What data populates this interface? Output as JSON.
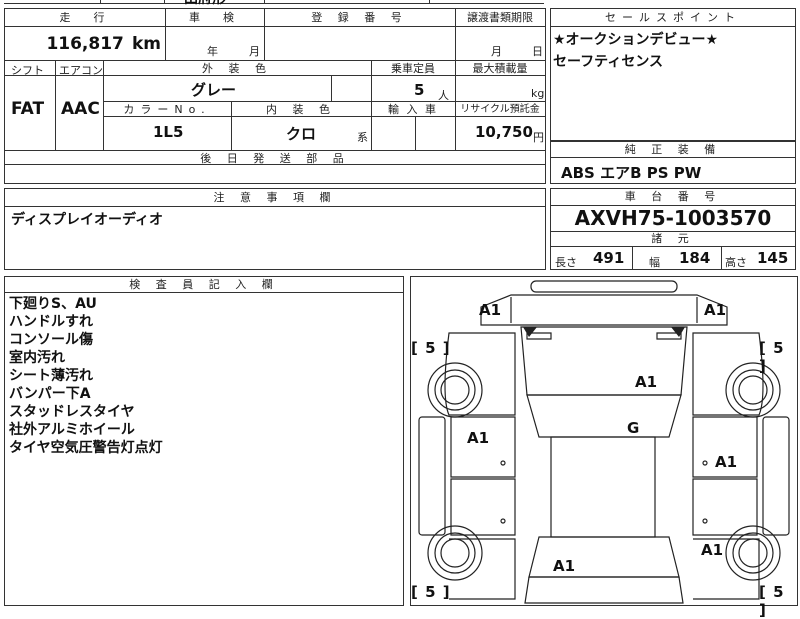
{
  "top_partial": {
    "text": "田府形"
  },
  "vehicle": {
    "mileage_label": "走　行",
    "mileage_value": "116,817",
    "mileage_unit": "km",
    "inspection_label": "車　検",
    "inspection_year": "年",
    "inspection_month": "月",
    "reg_label": "登 録 番 号",
    "transfer_label": "譲渡書類期限",
    "transfer_month": "月",
    "transfer_day": "日",
    "shift_label": "シフト",
    "shift_value": "FAT",
    "ac_label": "エアコン",
    "ac_value": "AAC",
    "exterior_label": "外 装 色",
    "exterior_value": "グレー",
    "capacity_label": "乗車定員",
    "capacity_value": "5",
    "capacity_unit": "人",
    "maxload_label": "最大積載量",
    "maxload_unit": "kg",
    "color_no_label": "カラーNo.",
    "color_no_value": "1L5",
    "interior_label": "内 装 色",
    "interior_value": "クロ",
    "interior_suffix": "系",
    "import_label": "輸 入 車",
    "recycle_label": "リサイクル預託金",
    "recycle_value": "10,750",
    "recycle_unit": "円",
    "later_parts_label": "後 日 発 送 部 品"
  },
  "sales_points": {
    "label": "セールスポイント",
    "lines": [
      "★オークションデビュー★",
      "セーフティセンス"
    ]
  },
  "equipment": {
    "label": "純 正 装 備",
    "value": "ABS エアB PS PW"
  },
  "notes": {
    "label": "注 意 事 項 欄",
    "value": "ディスプレイオーディオ"
  },
  "chassis": {
    "label": "車 台 番 号",
    "value": "AXVH75-1003570",
    "spec_label": "諸 元",
    "length_label": "長さ",
    "length_value": "491",
    "width_label": "幅",
    "width_value": "184",
    "height_label": "高さ",
    "height_value": "145"
  },
  "inspector": {
    "label": "検 査 員 記 入 欄",
    "lines": [
      "下廻りS、AU",
      "ハンドルすれ",
      "コンソール傷",
      "室内汚れ",
      "シート薄汚れ",
      "バンパー下A",
      "スタッドレスタイヤ",
      "社外アルミホイール",
      "タイヤ空気圧警告灯点灯"
    ]
  },
  "diagram": {
    "marks": {
      "front_left": "A1",
      "front_right": "A1",
      "tire_fl": "5",
      "tire_fr": "5",
      "tire_rl": "5",
      "tire_rr": "5",
      "hood": "A1",
      "windshield": "G",
      "door_left": "A1",
      "door_right": "A1",
      "rear_right": "A1",
      "rear_center": "A1",
      "bracket_open": "[",
      "bracket_close": "]"
    }
  }
}
